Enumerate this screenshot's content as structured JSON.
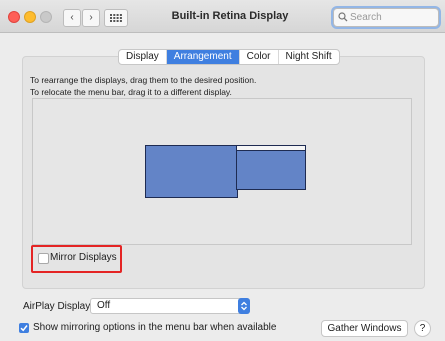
{
  "window": {
    "title": "Built-in Retina Display",
    "nav_back_icon": "‹",
    "nav_forward_icon": "›"
  },
  "search": {
    "placeholder": "Search"
  },
  "tabs": [
    {
      "label": "Display",
      "active": false
    },
    {
      "label": "Arrangement",
      "active": true
    },
    {
      "label": "Color",
      "active": false
    },
    {
      "label": "Night Shift",
      "active": false
    }
  ],
  "instructions": {
    "line1": "To rearrange the displays, drag them to the desired position.",
    "line2": "To relocate the menu bar, drag it to a different display."
  },
  "mirror": {
    "label": "Mirror Displays",
    "checked": false
  },
  "airplay": {
    "label": "AirPlay Display:",
    "value": "Off"
  },
  "show_mirroring": {
    "label": "Show mirroring options in the menu bar when available",
    "checked": true
  },
  "buttons": {
    "gather": "Gather Windows",
    "help": "?"
  },
  "colors": {
    "accent": "#3f7fe0",
    "display_fill": "#6384c7",
    "highlight": "#e42424"
  }
}
